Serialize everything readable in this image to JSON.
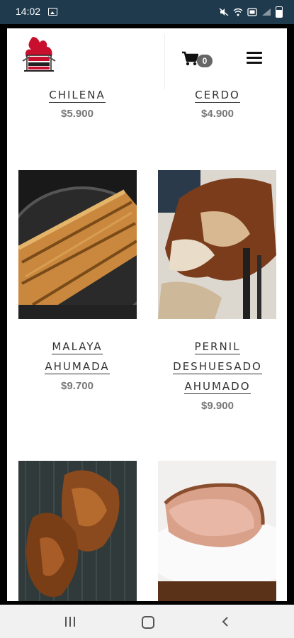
{
  "status_bar": {
    "time": "14:02"
  },
  "header": {
    "cart_count": "0"
  },
  "products": [
    {
      "name_lines": [
        "CHILENA"
      ],
      "price": "$5.900"
    },
    {
      "name_lines": [
        "CERDO"
      ],
      "price": "$4.900"
    },
    {
      "name_lines": [
        "MALAYA",
        "AHUMADA"
      ],
      "price": "$9.700"
    },
    {
      "name_lines": [
        "PERNIL",
        "DESHUESADO",
        "AHUMADO"
      ],
      "price": "$9.900"
    }
  ],
  "icons": {
    "cart": "cart-icon",
    "menu": "hamburger-menu-icon",
    "nav_recents": "recents-icon",
    "nav_home": "home-icon",
    "nav_back": "back-icon"
  }
}
